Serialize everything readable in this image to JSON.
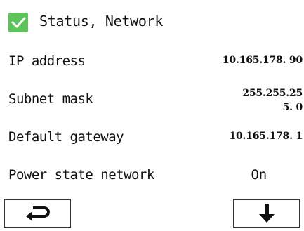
{
  "header": {
    "title": "Status, Network",
    "status_icon": "check-icon",
    "status_color": "#5cc45a"
  },
  "rows": [
    {
      "label": "IP address",
      "value": "10.165.178. 90"
    },
    {
      "label": "Subnet mask",
      "value": "255.255.255. 0"
    },
    {
      "label": "Default gateway",
      "value": "10.165.178. 1"
    },
    {
      "label": "Power state network",
      "value": "On"
    }
  ],
  "nav": {
    "back_icon": "return-arrow-icon",
    "down_icon": "arrow-down-icon"
  }
}
